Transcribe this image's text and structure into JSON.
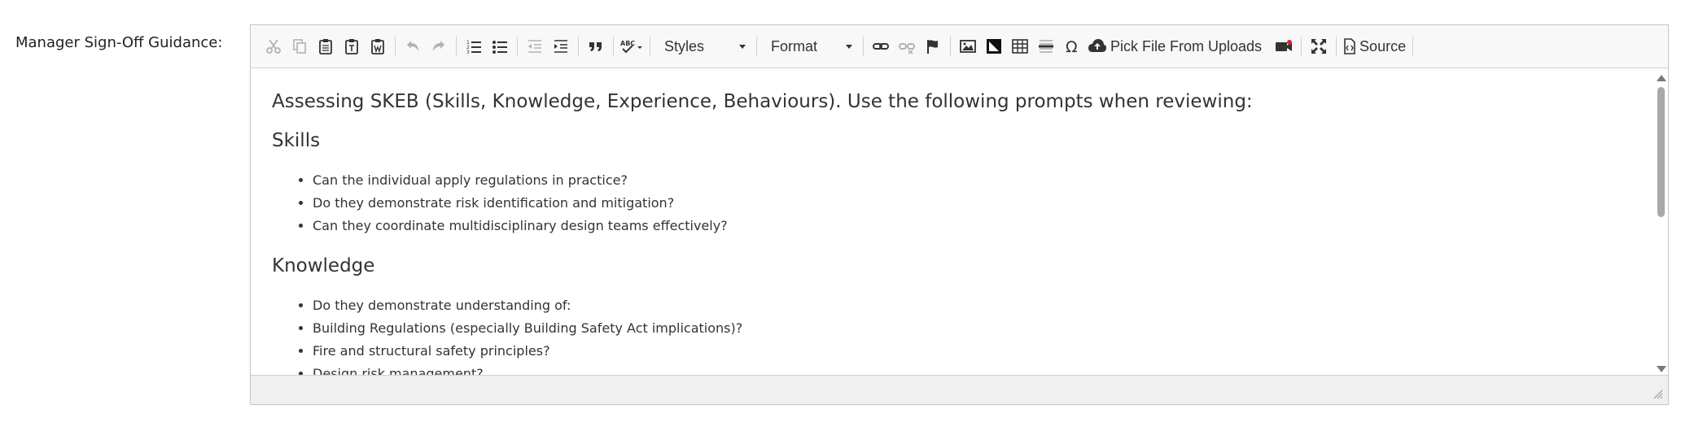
{
  "field": {
    "label": "Manager Sign-Off Guidance:"
  },
  "toolbar": {
    "styles_label": "Styles",
    "format_label": "Format",
    "pick_file_label": "Pick File From Uploads",
    "source_label": "Source",
    "icons": [
      "cut-icon",
      "copy-icon",
      "paste-icon",
      "paste-text-icon",
      "paste-word-icon",
      "undo-icon",
      "redo-icon",
      "numbered-list-icon",
      "bulleted-list-icon",
      "outdent-icon",
      "indent-icon",
      "blockquote-icon",
      "spellcheck-icon",
      "link-icon",
      "unlink-icon",
      "anchor-icon",
      "image-icon",
      "image-alt-icon",
      "table-icon",
      "horizontal-rule-icon",
      "special-char-icon",
      "cloud-upload-icon",
      "video-icon",
      "maximize-icon",
      "source-icon"
    ]
  },
  "content": {
    "intro": "Assessing SKEB (Skills, Knowledge, Experience, Behaviours). Use the following prompts when reviewing:",
    "skills_heading": "Skills",
    "skills": [
      "Can the individual apply regulations in practice?",
      "Do they demonstrate risk identification and mitigation?",
      "Can they coordinate multidisciplinary design teams effectively?"
    ],
    "knowledge_heading": "Knowledge",
    "knowledge": [
      "Do they demonstrate understanding of:",
      "Building Regulations (especially Building Safety Act implications)?",
      "Fire and structural safety principles?",
      "Design risk management?"
    ]
  }
}
